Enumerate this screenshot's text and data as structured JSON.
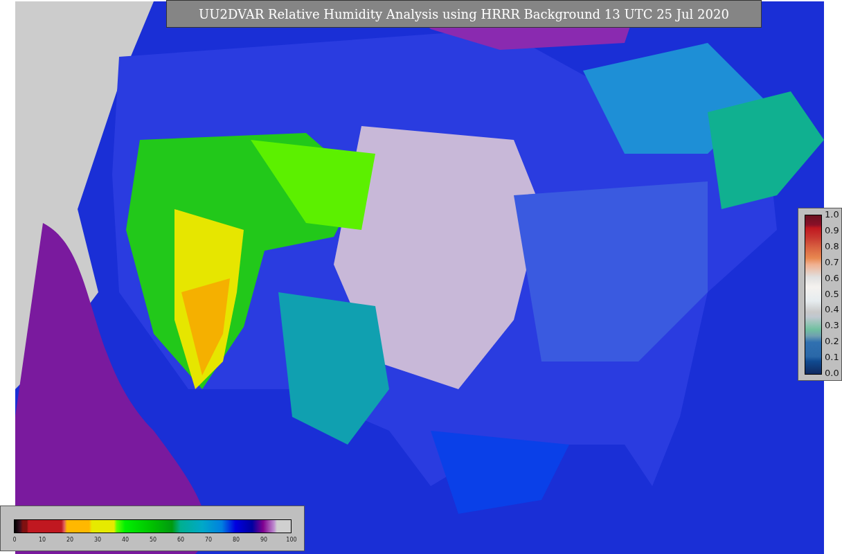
{
  "title": "UU2DVAR Relative Humidity Analysis using HRRR Background 13 UTC 25 Jul 2020",
  "humidity_colorbar": {
    "ticks": [
      "0",
      "10",
      "20",
      "30",
      "40",
      "50",
      "60",
      "70",
      "80",
      "90",
      "100"
    ]
  },
  "observation_colorbar": {
    "ticks": [
      "1.0",
      "0.9",
      "0.8",
      "0.7",
      "0.6",
      "0.5",
      "0.4",
      "0.3",
      "0.2",
      "0.1",
      "0.0"
    ]
  }
}
